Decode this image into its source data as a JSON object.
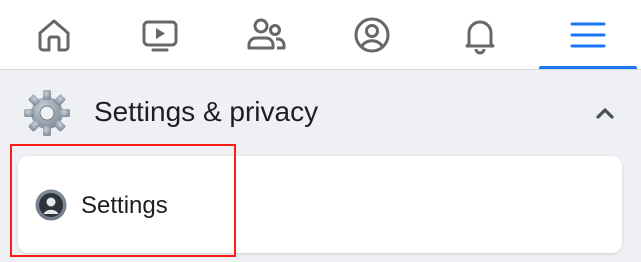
{
  "nav": {
    "items": [
      {
        "icon": "home-icon"
      },
      {
        "icon": "video-icon"
      },
      {
        "icon": "friends-icon"
      },
      {
        "icon": "profile-icon"
      },
      {
        "icon": "bell-icon"
      },
      {
        "icon": "menu-icon"
      }
    ],
    "active_index": 5,
    "icon_color": "#65676b",
    "active_color": "#1877f2"
  },
  "section": {
    "title": "Settings & privacy",
    "icon": "gear-icon",
    "expanded": true
  },
  "menu": {
    "items": [
      {
        "label": "Settings",
        "icon": "account-icon"
      }
    ]
  },
  "colors": {
    "background": "#eef0f3",
    "card": "#ffffff",
    "highlight": "#ff1a1a"
  }
}
